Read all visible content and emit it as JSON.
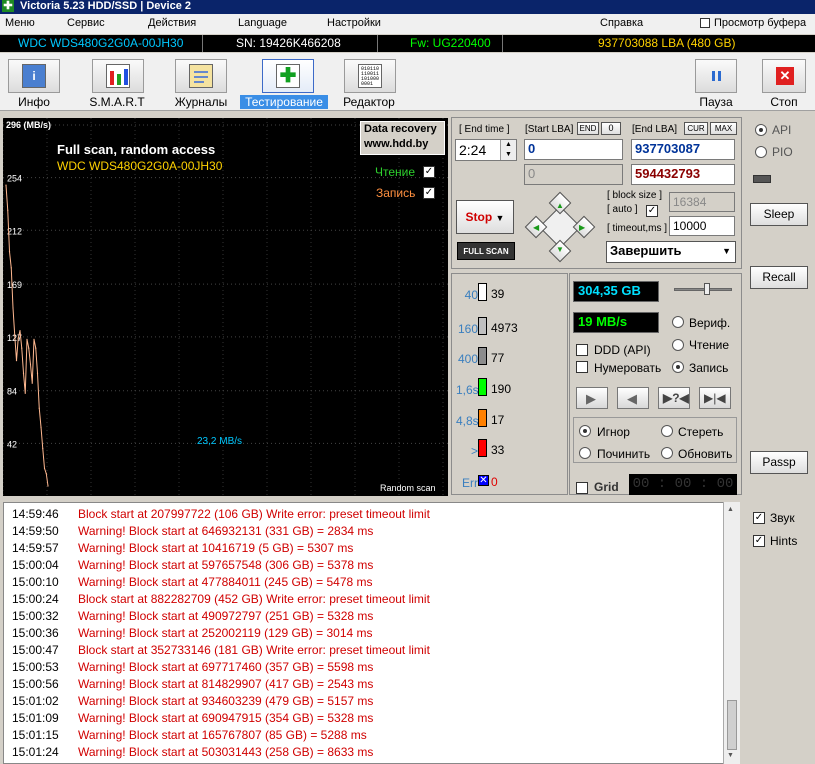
{
  "window": {
    "title": "Victoria 5.23 HDD/SSD | Device 2"
  },
  "menu": {
    "items": [
      "Меню",
      "Сервис",
      "Действия",
      "Language",
      "Настройки",
      "Справка"
    ],
    "preview": "Просмотр буфера"
  },
  "drive": {
    "model": "WDC WDS480G2G0A-00JH30",
    "sn": "SN: 19426K466208",
    "fw": "Fw: UG220400",
    "lba": "937703088 LBA (480 GB)"
  },
  "toolbar": {
    "info": "Инфо",
    "smart": "S.M.A.R.T",
    "journals": "Журналы",
    "testing": "Тестирование",
    "editor": "Редактор",
    "pause": "Пауза",
    "stop": "Стоп",
    "editor_glyph": "010110 110011 101000 0001"
  },
  "chart": {
    "ylabel_unit": "296 (MB/s)",
    "title": "Full scan, random access",
    "model": "WDC WDS480G2G0A-00JH30",
    "ad1": "Data recovery",
    "ad2": "www.hdd.by",
    "read_label": "Чтение",
    "write_label": "Запись",
    "speed_label": "23,2 MB/s",
    "mode_label": "Random scan",
    "check": "✓"
  },
  "chart_data": {
    "type": "line",
    "yticks": [
      296,
      254,
      212,
      169,
      127,
      84,
      42
    ],
    "ylim": [
      0,
      296
    ],
    "series": [
      {
        "values": [
          248,
          228,
          195,
          182,
          150,
          128,
          108,
          126,
          132,
          118,
          98,
          82,
          125,
          118,
          105,
          90,
          125,
          118,
          98,
          70,
          55,
          38,
          22,
          18,
          8
        ]
      }
    ]
  },
  "scan": {
    "end_time_label": "[ End time ]",
    "end_time": "2:24",
    "start_lba_label": "[Start LBA]",
    "end_label": "END",
    "zero_btn": "0",
    "end_lba_label": "[End LBA]",
    "cur_btn": "CUR",
    "max_btn": "MAX",
    "start_lba": "0",
    "end_lba": "937703087",
    "cur_start": "0",
    "cur_end": "594432793",
    "block_size_label": "[ block size ]",
    "auto_label": "[ auto ]",
    "block_size": "16384",
    "timeout_label": "[ timeout,ms ]",
    "timeout": "10000",
    "stop_btn": "Stop",
    "fullscan_btn": "FULL SCAN",
    "finish": "Завершить"
  },
  "legend": [
    {
      "label": "40",
      "color": "#ffffff",
      "count": "39"
    },
    {
      "label": "160",
      "color": "#c0c0c0",
      "count": "4973"
    },
    {
      "label": "400",
      "color": "#8c8c8c",
      "count": "77"
    },
    {
      "label": "1,6s",
      "color": "#00ff00",
      "count": "190"
    },
    {
      "label": "4,8s",
      "color": "#ff8000",
      "count": "17"
    },
    {
      "label": ">",
      "color": "#ff0000",
      "count": "33"
    },
    {
      "label": "Err",
      "color": "#0000ff",
      "count": "0"
    }
  ],
  "stats": {
    "position": "304,35 GB",
    "speed": "19 MB/s",
    "ddd": "DDD (API)",
    "numerate": "Нумеровать",
    "verify": "Вериф.",
    "read": "Чтение",
    "write": "Запись",
    "ignore": "Игнор",
    "erase": "Стереть",
    "repair": "Починить",
    "refresh": "Обновить",
    "grid": "Grid",
    "timer": "00 : 00 : 00"
  },
  "side": {
    "api": "API",
    "pio": "PIO",
    "sleep": "Sleep",
    "recall": "Recall",
    "passp": "Passp",
    "sound": "Звук",
    "hints": "Hints"
  },
  "log": [
    {
      "time": "14:59:46",
      "msg": "Block start at 207997722 (106 GB) Write error: preset timeout limit"
    },
    {
      "time": "14:59:50",
      "msg": "Warning! Block start at 646932131 (331 GB)  = 2834 ms"
    },
    {
      "time": "14:59:57",
      "msg": "Warning! Block start at 10416719 (5 GB)  = 5307 ms"
    },
    {
      "time": "15:00:04",
      "msg": "Warning! Block start at 597657548 (306 GB)  = 5378 ms"
    },
    {
      "time": "15:00:10",
      "msg": "Warning! Block start at 477884011 (245 GB)  = 5478 ms"
    },
    {
      "time": "15:00:24",
      "msg": "Block start at 882282709 (452 GB) Write error: preset timeout limit"
    },
    {
      "time": "15:00:32",
      "msg": "Warning! Block start at 490972797 (251 GB)  = 5328 ms"
    },
    {
      "time": "15:00:36",
      "msg": "Warning! Block start at 252002119 (129 GB)  = 3014 ms"
    },
    {
      "time": "15:00:47",
      "msg": "Block start at 352733146 (181 GB) Write error: preset timeout limit"
    },
    {
      "time": "15:00:53",
      "msg": "Warning! Block start at 697717460 (357 GB)  = 5598 ms"
    },
    {
      "time": "15:00:56",
      "msg": "Warning! Block start at 814829907 (417 GB)  = 2543 ms"
    },
    {
      "time": "15:01:02",
      "msg": "Warning! Block start at 934603239 (479 GB)  = 5157 ms"
    },
    {
      "time": "15:01:09",
      "msg": "Warning! Block start at 690947915 (354 GB)  = 5328 ms"
    },
    {
      "time": "15:01:15",
      "msg": "Warning! Block start at 165767807 (85 GB)  = 5288 ms"
    },
    {
      "time": "15:01:24",
      "msg": "Warning! Block start at 503031443 (258 GB)  = 8633 ms"
    }
  ]
}
